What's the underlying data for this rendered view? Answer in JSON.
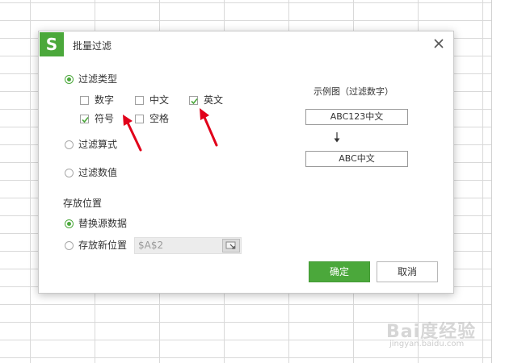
{
  "dialog": {
    "title": "批量过滤",
    "logo_glyph": "S",
    "close_glyph": "×",
    "colors": {
      "accent": "#4ba83b",
      "arrow": "#e1001a"
    }
  },
  "filter_mode": {
    "options": [
      {
        "label": "过滤类型",
        "checked": true
      },
      {
        "label": "过滤算式",
        "checked": false
      },
      {
        "label": "过滤数值",
        "checked": false
      }
    ]
  },
  "filter_types": [
    {
      "label": "数字",
      "checked": false
    },
    {
      "label": "中文",
      "checked": false
    },
    {
      "label": "英文",
      "checked": true
    },
    {
      "label": "符号",
      "checked": true
    },
    {
      "label": "空格",
      "checked": false
    }
  ],
  "example": {
    "caption": "示例图（过滤数字）",
    "before": "ABC123中文",
    "after": "ABC中文"
  },
  "storage": {
    "heading": "存放位置",
    "options": [
      {
        "label": "替换源数据",
        "checked": true
      },
      {
        "label": "存放新位置",
        "checked": false
      }
    ],
    "address_value": "$A$2"
  },
  "buttons": {
    "ok": "确定",
    "cancel": "取消"
  },
  "watermark": {
    "main": "Bai度经验",
    "sub": "jingyan.baidu.com"
  }
}
